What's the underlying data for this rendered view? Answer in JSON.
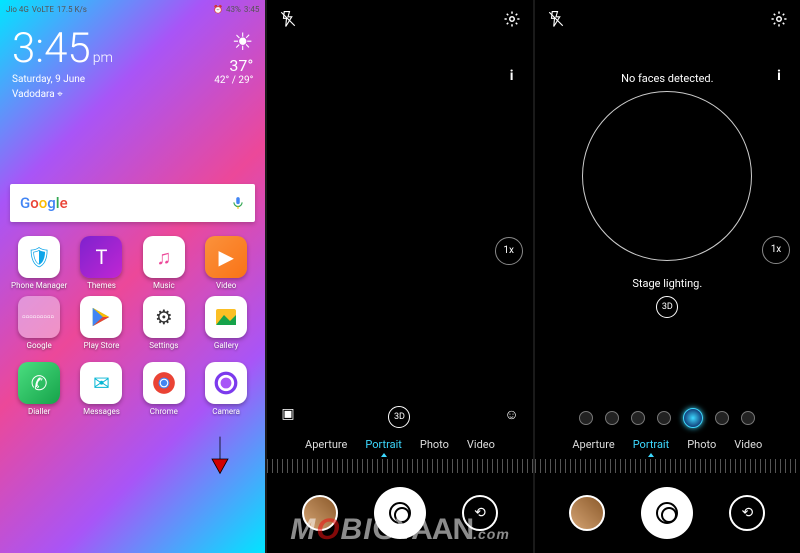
{
  "status": {
    "carrier": "Jio 4G",
    "volte": "VoLTE",
    "speed": "17.5 K/s",
    "battery": "43%",
    "time": "3:45"
  },
  "homescreen": {
    "clock": {
      "time": "3:45",
      "ampm": "pm",
      "date": "Saturday, 9 June",
      "location": "Vadodara"
    },
    "weather": {
      "temp": "37°",
      "range": "42° / 29°",
      "glyph": "☀"
    },
    "search": {
      "logo": "Google",
      "mic": "mic-icon"
    },
    "apps": [
      {
        "label": "Phone Manager",
        "bg": "#fff",
        "glyph": "🛡️"
      },
      {
        "label": "Themes",
        "bg": "linear-gradient(135deg,#7e22ce,#c026d3)",
        "glyph": "🅣"
      },
      {
        "label": "Music",
        "bg": "#fff",
        "glyph": "🎵"
      },
      {
        "label": "Video",
        "bg": "linear-gradient(135deg,#fb923c,#f97316)",
        "glyph": "▶"
      },
      {
        "label": "Google",
        "bg": "#fff",
        "glyph": "▦"
      },
      {
        "label": "Play Store",
        "bg": "#fff",
        "glyph": "▶"
      },
      {
        "label": "Settings",
        "bg": "#fff",
        "glyph": "⚙"
      },
      {
        "label": "Gallery",
        "bg": "#fff",
        "glyph": "🖼"
      }
    ],
    "dock": [
      {
        "label": "Dialler",
        "bg": "linear-gradient(135deg,#4ade80,#16a34a)",
        "glyph": "📞"
      },
      {
        "label": "Messages",
        "bg": "#fff",
        "glyph": "💬"
      },
      {
        "label": "Chrome",
        "bg": "#fff",
        "glyph": "◉"
      },
      {
        "label": "Camera",
        "bg": "#fff",
        "glyph": "📷"
      }
    ]
  },
  "camera": {
    "zoom": "1x",
    "no_faces": "No faces detected.",
    "stage_lighting": "Stage lighting.",
    "effect_label": "3D",
    "modes": [
      "Aperture",
      "Portrait",
      "Photo",
      "Video"
    ],
    "active_mode": "Portrait",
    "effect_icons": {
      "live": "▢",
      "3d": "3D",
      "beauty": "☺"
    }
  },
  "watermark": "MOBIGYAAN"
}
